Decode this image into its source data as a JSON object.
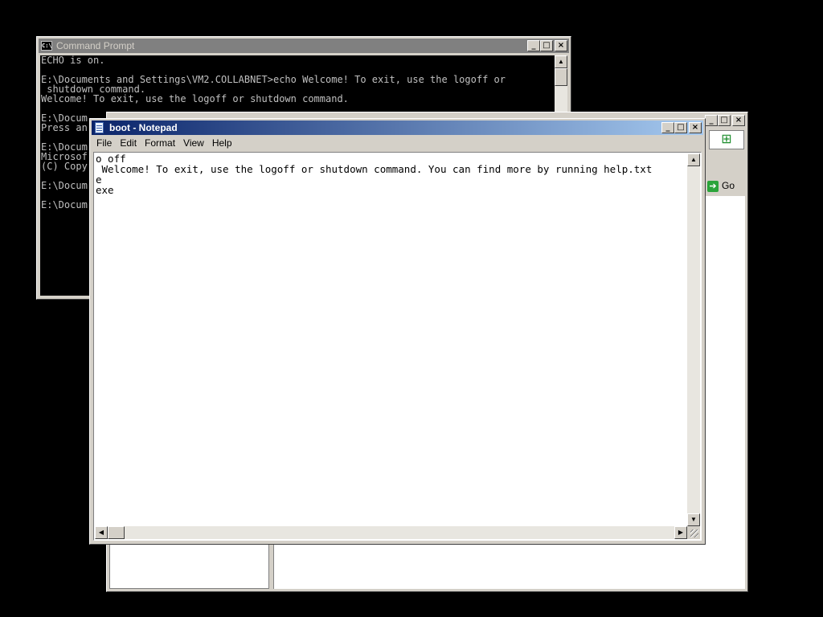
{
  "cmd": {
    "title": "Command Prompt",
    "lines": [
      "ECHO is on.",
      "",
      "E:\\Documents and Settings\\VM2.COLLABNET>echo Welcome! To exit, use the logoff or",
      " shutdown command.",
      "Welcome! To exit, use the logoff or shutdown command.",
      "",
      "E:\\Docum",
      "Press an",
      "",
      "E:\\Docum",
      "Microsof",
      "(C) Copy",
      "",
      "E:\\Docum",
      "",
      "E:\\Docum"
    ]
  },
  "ie": {
    "go_label": "Go",
    "logo_icon": "windows-flag-icon"
  },
  "notepad": {
    "title": "boot - Notepad",
    "menu": [
      "File",
      "Edit",
      "Format",
      "View",
      "Help"
    ],
    "text_lines": [
      "o off",
      " Welcome! To exit, use the logoff or shutdown command. You can find more by running help.txt",
      "e",
      "exe"
    ]
  }
}
